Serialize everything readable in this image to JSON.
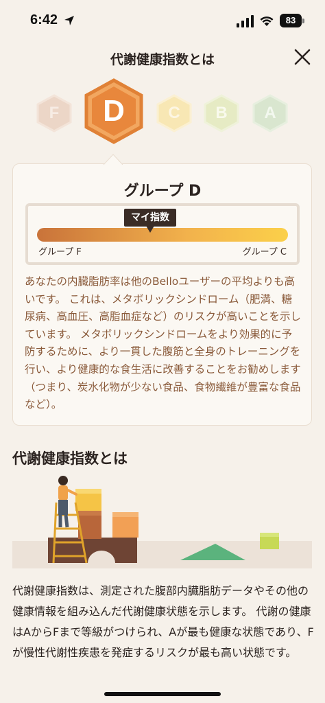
{
  "status": {
    "time": "6:42",
    "battery": "83"
  },
  "header": {
    "title": "代謝健康指数とは"
  },
  "grades": [
    {
      "letter": "F",
      "active": false,
      "color": "#e8c7b3"
    },
    {
      "letter": "D",
      "active": true,
      "color": "#e8873c"
    },
    {
      "letter": "C",
      "active": false,
      "color": "#f7e3a8"
    },
    {
      "letter": "B",
      "active": false,
      "color": "#dfe6b6"
    },
    {
      "letter": "A",
      "active": false,
      "color": "#cfe0c2"
    }
  ],
  "card": {
    "group_title": "グループ D",
    "marker_label": "マイ指数",
    "marker_position": 0.5,
    "scale_left": "グループ F",
    "scale_right": "グループ C",
    "description": "あなたの内臓脂肪率は他のBelloユーザーの平均よりも高いです。 これは、メタボリックシンドローム（肥満、糖尿病、高血圧、高脂血症など）のリスクが高いことを示しています。 メタボリックシンドロームをより効果的に予防するために、より一貫した腹筋と全身のトレーニングを行い、より健康的な食生活に改善することをお勧めします（つまり、炭水化物が少ない食品、食物繊維が豊富な食品など）。"
  },
  "section": {
    "title": "代謝健康指数とは",
    "body": "代謝健康指数は、測定された腹部内臓脂肪データやその他の健康情報を組み込んだ代謝健康状態を示します。 代謝の健康はAからFまで等級がつけられ、Aが最も健康な状態であり、Fが慢性代謝性疾患を発症するリスクが最も高い状態です。"
  },
  "colors": {
    "accent": "#e8873c",
    "background": "#f6f1ea",
    "text_brown": "#8a5a3a"
  }
}
